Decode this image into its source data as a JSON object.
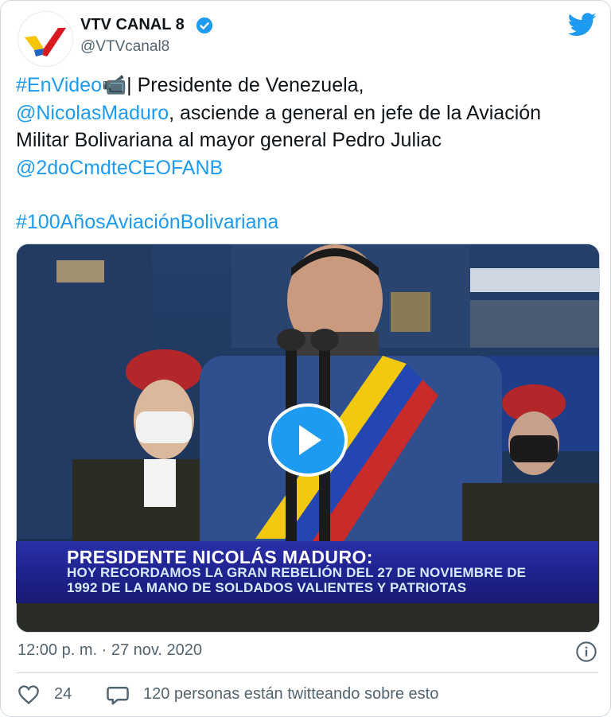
{
  "header": {
    "display_name": "VTV CANAL 8",
    "handle": "@VTVcanal8",
    "verified": true,
    "brand_icon": "twitter-bird-icon"
  },
  "tweet": {
    "hashtag_video": "#EnVideo",
    "camera_emoji": "📹",
    "text_part1": "| Presidente de Venezuela,",
    "mention_president": "@NicolasMaduro",
    "text_part2": ", asciende a general en jefe de la Aviación Militar Bolivariana al mayor general Pedro Juliac ",
    "mention_cmdt": "@2doCmdteCEOFANB",
    "hashtag_anniversary": "#100AñosAviaciónBolivariana"
  },
  "media": {
    "type": "video",
    "caption_title": "PRESIDENTE NICOLÁS MADURO:",
    "caption_line1": "HOY RECORDAMOS LA GRAN REBELIÓN DEL 27 DE NOVIEMBRE DE",
    "caption_line2": "1992 DE LA MANO DE SOLDADOS VALIENTES Y PATRIOTAS"
  },
  "meta": {
    "timestamp": "12:00 p. m. · 27 nov. 2020"
  },
  "actions": {
    "likes_count": "24",
    "conversation_text": "120 personas están twitteando sobre esto"
  },
  "colors": {
    "link": "#1d9bf0",
    "secondary_text": "#536471",
    "caption_band": "#1f2390"
  }
}
